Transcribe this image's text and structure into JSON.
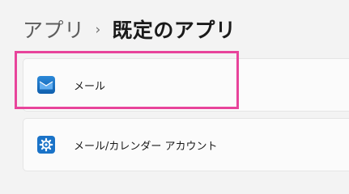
{
  "breadcrumb": {
    "parent": "アプリ",
    "separator": "›",
    "current": "既定のアプリ"
  },
  "apps": [
    {
      "name": "メール",
      "icon": "mail-icon",
      "icon_color": "#0f6cbd"
    },
    {
      "name": "メール/カレンダー アカウント",
      "icon": "gear-icon",
      "icon_color": "#1a73c8"
    }
  ],
  "colors": {
    "highlight": "#e8449b"
  }
}
